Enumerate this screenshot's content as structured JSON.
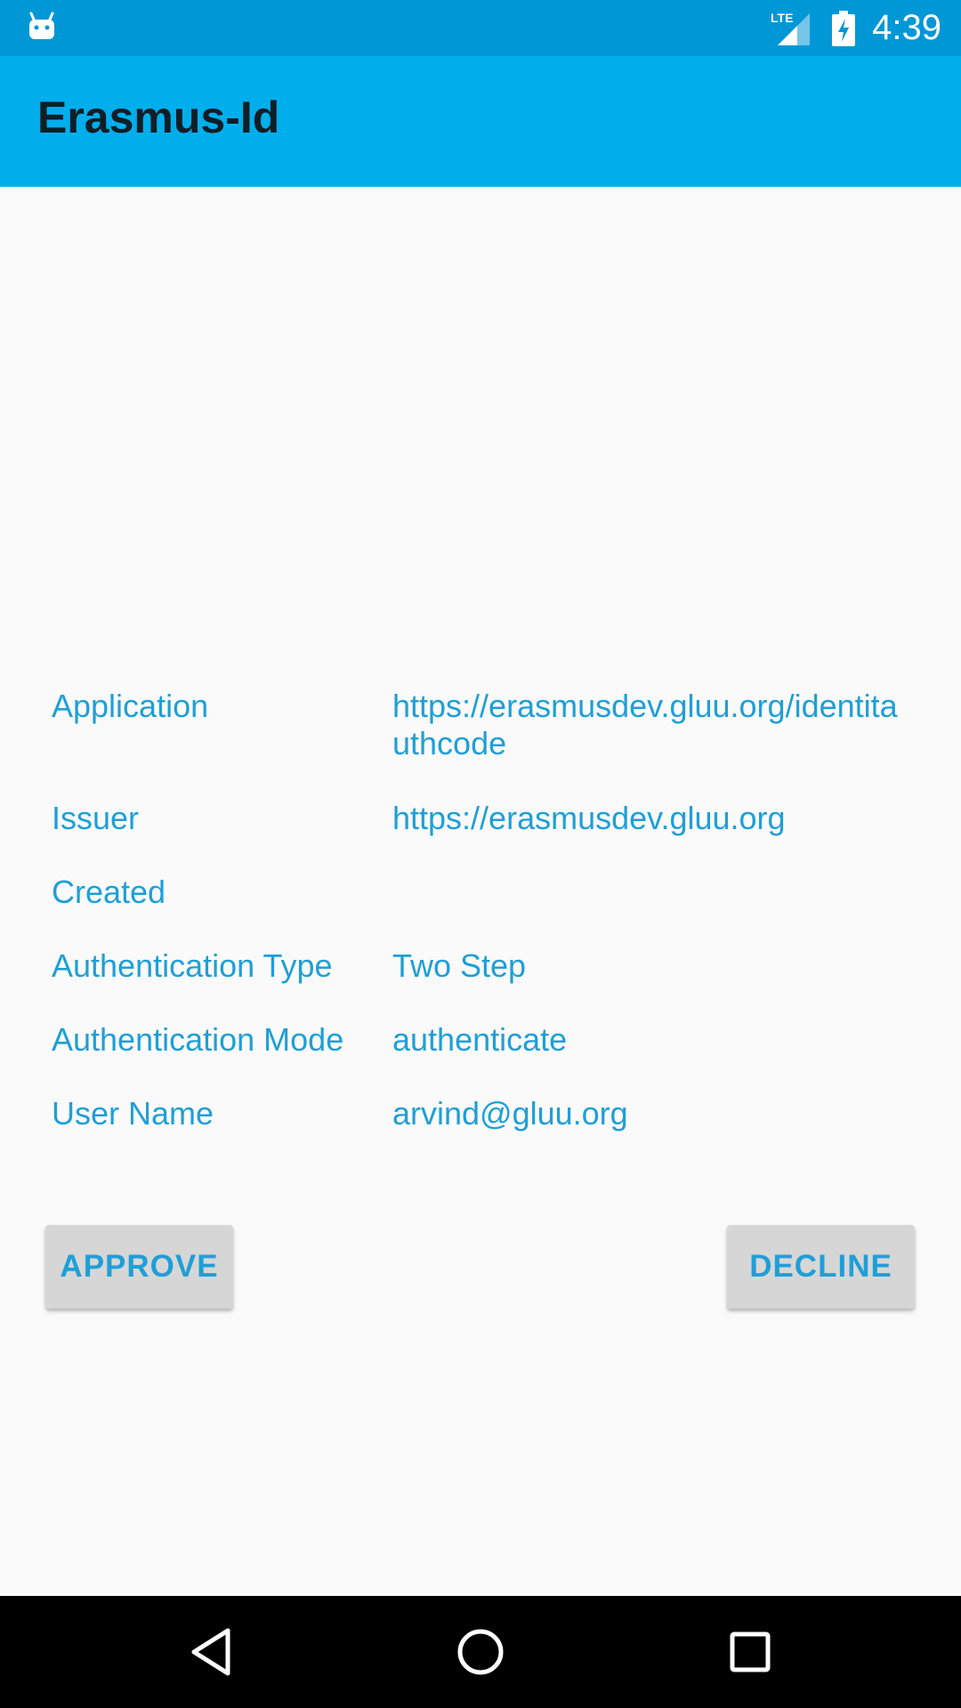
{
  "status_bar": {
    "network_label": "LTE",
    "time": "4:39"
  },
  "app_bar": {
    "title": "Erasmus-Id"
  },
  "details": {
    "application_label": "Application",
    "application_value": "https://erasmusdev.gluu.org/identitauthcode",
    "issuer_label": "Issuer",
    "issuer_value": "https://erasmusdev.gluu.org",
    "created_label": "Created",
    "created_value": "",
    "auth_type_label": "Authentication Type",
    "auth_type_value": "Two Step",
    "auth_mode_label": "Authentication Mode",
    "auth_mode_value": "authenticate",
    "user_name_label": "User Name",
    "user_name_value": "arvind@gluu.org"
  },
  "actions": {
    "approve_label": "APPROVE",
    "decline_label": "DECLINE"
  },
  "icons": {
    "status_left": "android-icon",
    "signal": "lte-signal-icon",
    "battery": "battery-charging-icon",
    "nav_back": "back-icon",
    "nav_home": "home-icon",
    "nav_recent": "recent-apps-icon"
  },
  "colors": {
    "status_bar": "#0097d6",
    "app_bar": "#00aeec",
    "accent_text": "#1f9fd7",
    "button_bg": "#d6d6d6",
    "background": "#fafafa"
  }
}
